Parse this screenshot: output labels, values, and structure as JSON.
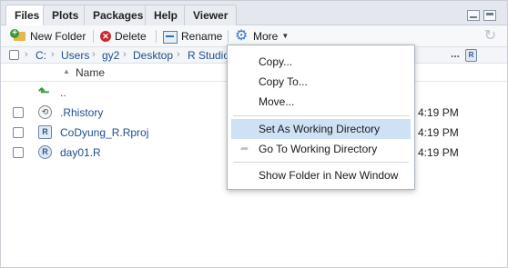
{
  "tabs": [
    {
      "label": "Files",
      "active": true
    },
    {
      "label": "Plots",
      "active": false
    },
    {
      "label": "Packages",
      "active": false
    },
    {
      "label": "Help",
      "active": false
    },
    {
      "label": "Viewer",
      "active": false
    }
  ],
  "toolbar": {
    "new_folder": "New Folder",
    "delete": "Delete",
    "rename": "Rename",
    "more": "More"
  },
  "breadcrumb": [
    "C:",
    "Users",
    "gy2",
    "Desktop",
    "R Studio"
  ],
  "breadcrumb_overflow": "...",
  "columns": {
    "name": "Name"
  },
  "up_label": "..",
  "files": [
    {
      "name": ".Rhistory",
      "modified": "4:19 PM",
      "icon": "history-file-icon"
    },
    {
      "name": "CoDyung_R.Rproj",
      "modified": "4:19 PM",
      "icon": "rproj-file-icon"
    },
    {
      "name": "day01.R",
      "modified": "4:19 PM",
      "icon": "r-script-icon"
    }
  ],
  "menu": {
    "copy": "Copy...",
    "copy_to": "Copy To...",
    "move": "Move...",
    "set_wd": "Set As Working Directory",
    "goto_wd": "Go To Working Directory",
    "show_folder": "Show Folder in New Window",
    "highlighted": "set_wd"
  },
  "colors": {
    "accent": "#3f78c0",
    "menu_highlight": "#cfe2f5",
    "link": "#1f4f8a"
  }
}
